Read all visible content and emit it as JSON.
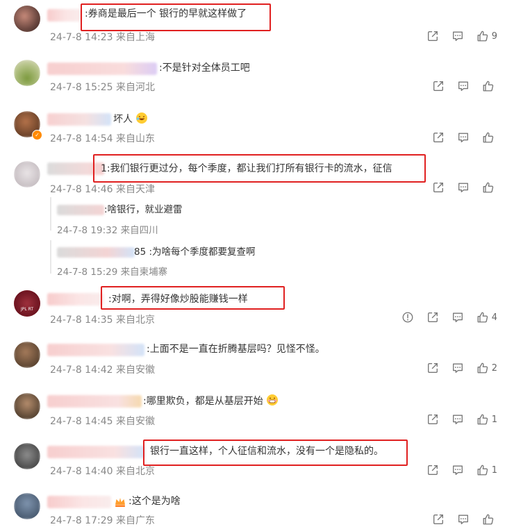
{
  "comments": [
    {
      "text": ":券商是最后一个 银行的早就这样做了",
      "meta": "24-7-8 14:23 来自上海",
      "likes": "9"
    },
    {
      "text": ":不是针对全体员工吧",
      "meta": "24-7-8 15:25 来自河北",
      "likes": ""
    },
    {
      "text": "坏人",
      "meta": "24-7-8 14:54 来自山东",
      "likes": ""
    },
    {
      "text": "1:我们银行更过分，每个季度，都让我们打所有银行卡的流水，征信",
      "meta": "24-7-8 14:46 来自天津",
      "likes": ""
    },
    {
      "text": ":对啊，弄得好像炒股能赚钱一样",
      "meta": "24-7-8 14:35 来自北京",
      "likes": "4"
    },
    {
      "text": ":上面不是一直在折腾基层吗？见怪不怪。",
      "meta": "24-7-8 14:42 来自安徽",
      "likes": "2"
    },
    {
      "text": ":哪里欺负，都是从基层开始",
      "meta": "24-7-8 14:45 来自安徽",
      "likes": "1"
    },
    {
      "text": "银行一直这样，个人征信和流水，没有一个是隐私的。",
      "meta": "24-7-8 14:40 来自北京",
      "likes": "1"
    },
    {
      "text": ":这个是为啥",
      "meta": "24-7-8 17:29 来自广东",
      "likes": ""
    }
  ],
  "replies": [
    {
      "text": ":啥银行，就业避雷",
      "meta": "24-7-8 19:32 来自四川"
    },
    {
      "text": "85 :为啥每个季度都要复查啊",
      "meta": "24-7-8 15:29 来自柬埔寨"
    }
  ],
  "avatar_label": "JPL RT",
  "icons": {
    "share": "share-icon",
    "comment": "comment-icon",
    "like": "like-icon",
    "report": "report-icon"
  },
  "colors": {
    "highlight": "#e02020",
    "meta": "#888888",
    "text": "#333333"
  }
}
